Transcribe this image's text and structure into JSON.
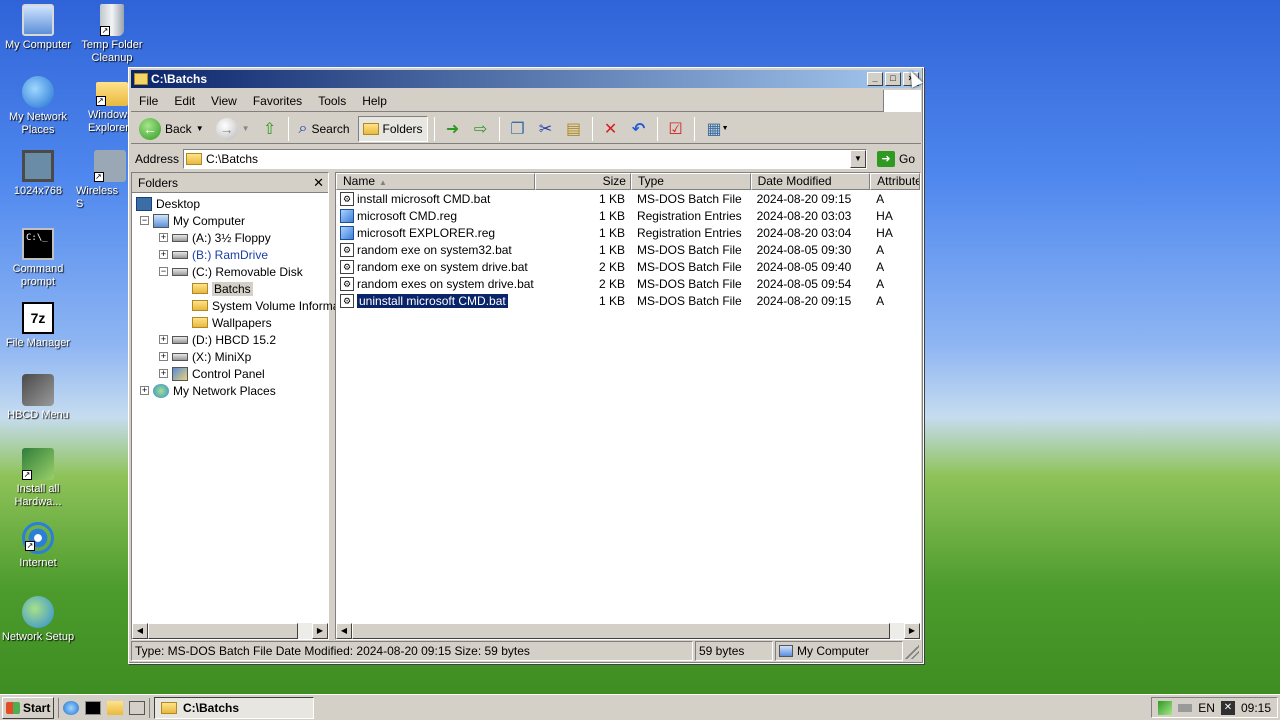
{
  "desktop": {
    "icons": [
      {
        "label": "My Computer",
        "icon": "my-computer-icon"
      },
      {
        "label": "Temp Folder Cleanup",
        "icon": "recycle-bin-icon"
      },
      {
        "label": "My Network Places",
        "icon": "network-places-icon"
      },
      {
        "label": "Windows Explorer",
        "icon": "windows-explorer-icon"
      },
      {
        "label": "1024x768",
        "icon": "display-icon"
      },
      {
        "label": "Wireless S",
        "icon": "wireless-icon"
      },
      {
        "label": "Command prompt",
        "icon": "command-prompt-icon"
      },
      {
        "label": "File Manager",
        "icon": "7z-icon"
      },
      {
        "label": "HBCD Menu",
        "icon": "tools-icon"
      },
      {
        "label": "Install all Hardwa...",
        "icon": "hardware-icon"
      },
      {
        "label": "Internet",
        "icon": "internet-explorer-icon"
      },
      {
        "label": "Network Setup",
        "icon": "network-setup-icon"
      }
    ]
  },
  "window": {
    "title": "C:\\Batchs",
    "menu": [
      "File",
      "Edit",
      "View",
      "Favorites",
      "Tools",
      "Help"
    ],
    "toolbar": {
      "back": "Back",
      "search": "Search",
      "folders": "Folders"
    },
    "address": {
      "label": "Address",
      "value": "C:\\Batchs",
      "go": "Go"
    },
    "folders_pane": {
      "title": "Folders",
      "tree": {
        "desktop": "Desktop",
        "my_computer": "My Computer",
        "floppy": "(A:) 3½ Floppy",
        "ramdrive": "(B:) RamDrive",
        "removable": "(C:) Removable Disk",
        "batchs": "Batchs",
        "svi": "System Volume Informati",
        "wallpapers": "Wallpapers",
        "hbcd": "(D:) HBCD 15.2",
        "minixp": "(X:) MiniXp",
        "control_panel": "Control Panel",
        "network": "My Network Places"
      }
    },
    "files": {
      "columns": [
        "Name",
        "Size",
        "Type",
        "Date Modified",
        "Attributes"
      ],
      "rows": [
        {
          "name": "install microsoft CMD.bat",
          "size": "1 KB",
          "type": "MS-DOS Batch File",
          "date": "2024-08-20 09:15",
          "attr": "A",
          "kind": "bat"
        },
        {
          "name": "microsoft CMD.reg",
          "size": "1 KB",
          "type": "Registration Entries",
          "date": "2024-08-20 03:03",
          "attr": "HA",
          "kind": "reg"
        },
        {
          "name": "microsoft EXPLORER.reg",
          "size": "1 KB",
          "type": "Registration Entries",
          "date": "2024-08-20 03:04",
          "attr": "HA",
          "kind": "reg"
        },
        {
          "name": "random exe on system32.bat",
          "size": "1 KB",
          "type": "MS-DOS Batch File",
          "date": "2024-08-05 09:30",
          "attr": "A",
          "kind": "bat"
        },
        {
          "name": "random exe on system drive.bat",
          "size": "2 KB",
          "type": "MS-DOS Batch File",
          "date": "2024-08-05 09:40",
          "attr": "A",
          "kind": "bat"
        },
        {
          "name": "random exes on system drive.bat",
          "size": "2 KB",
          "type": "MS-DOS Batch File",
          "date": "2024-08-05 09:54",
          "attr": "A",
          "kind": "bat"
        },
        {
          "name": "uninstall microsoft CMD.bat",
          "size": "1 KB",
          "type": "MS-DOS Batch File",
          "date": "2024-08-20 09:15",
          "attr": "A",
          "kind": "bat",
          "selected": true
        }
      ]
    },
    "status": {
      "info": "Type: MS-DOS Batch File Date Modified: 2024-08-20 09:15 Size: 59 bytes",
      "size": "59 bytes",
      "zone": "My Computer"
    }
  },
  "taskbar": {
    "start": "Start",
    "task": "C:\\Batchs",
    "lang": "EN",
    "clock": "09:15"
  }
}
